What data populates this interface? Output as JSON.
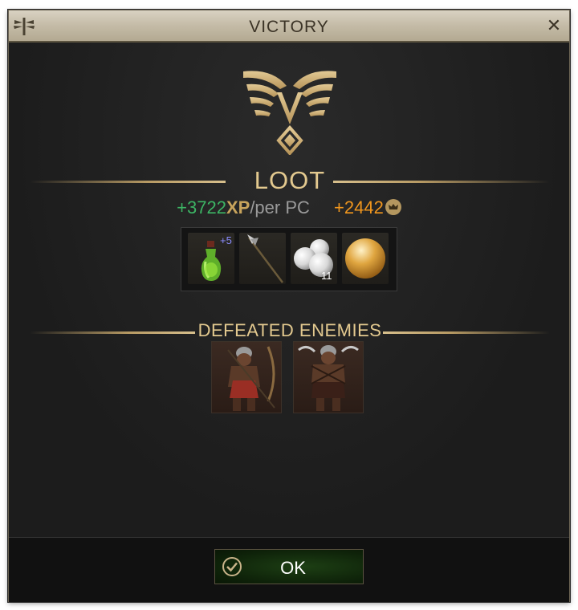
{
  "window": {
    "title": "VICTORY"
  },
  "loot": {
    "heading": "LOOT",
    "xp_value": "+3722",
    "xp_unit": "XP",
    "xp_suffix": "/per PC",
    "gold_value": "+2442",
    "items": [
      {
        "icon": "green-potion-icon",
        "badge": "+5"
      },
      {
        "icon": "spear-icon"
      },
      {
        "icon": "pearls-icon",
        "quantity": "11"
      },
      {
        "icon": "golden-pearl-icon"
      }
    ]
  },
  "enemies": {
    "heading": "DEFEATED ENEMIES",
    "list": [
      {
        "icon": "orc-archer-portrait"
      },
      {
        "icon": "orc-warrior-portrait"
      }
    ]
  },
  "footer": {
    "ok_label": "OK"
  },
  "colors": {
    "xp": "#3cb464",
    "gold": "#f0961e",
    "accent": "#e3c98f",
    "titlebar": "#c4bba7"
  }
}
